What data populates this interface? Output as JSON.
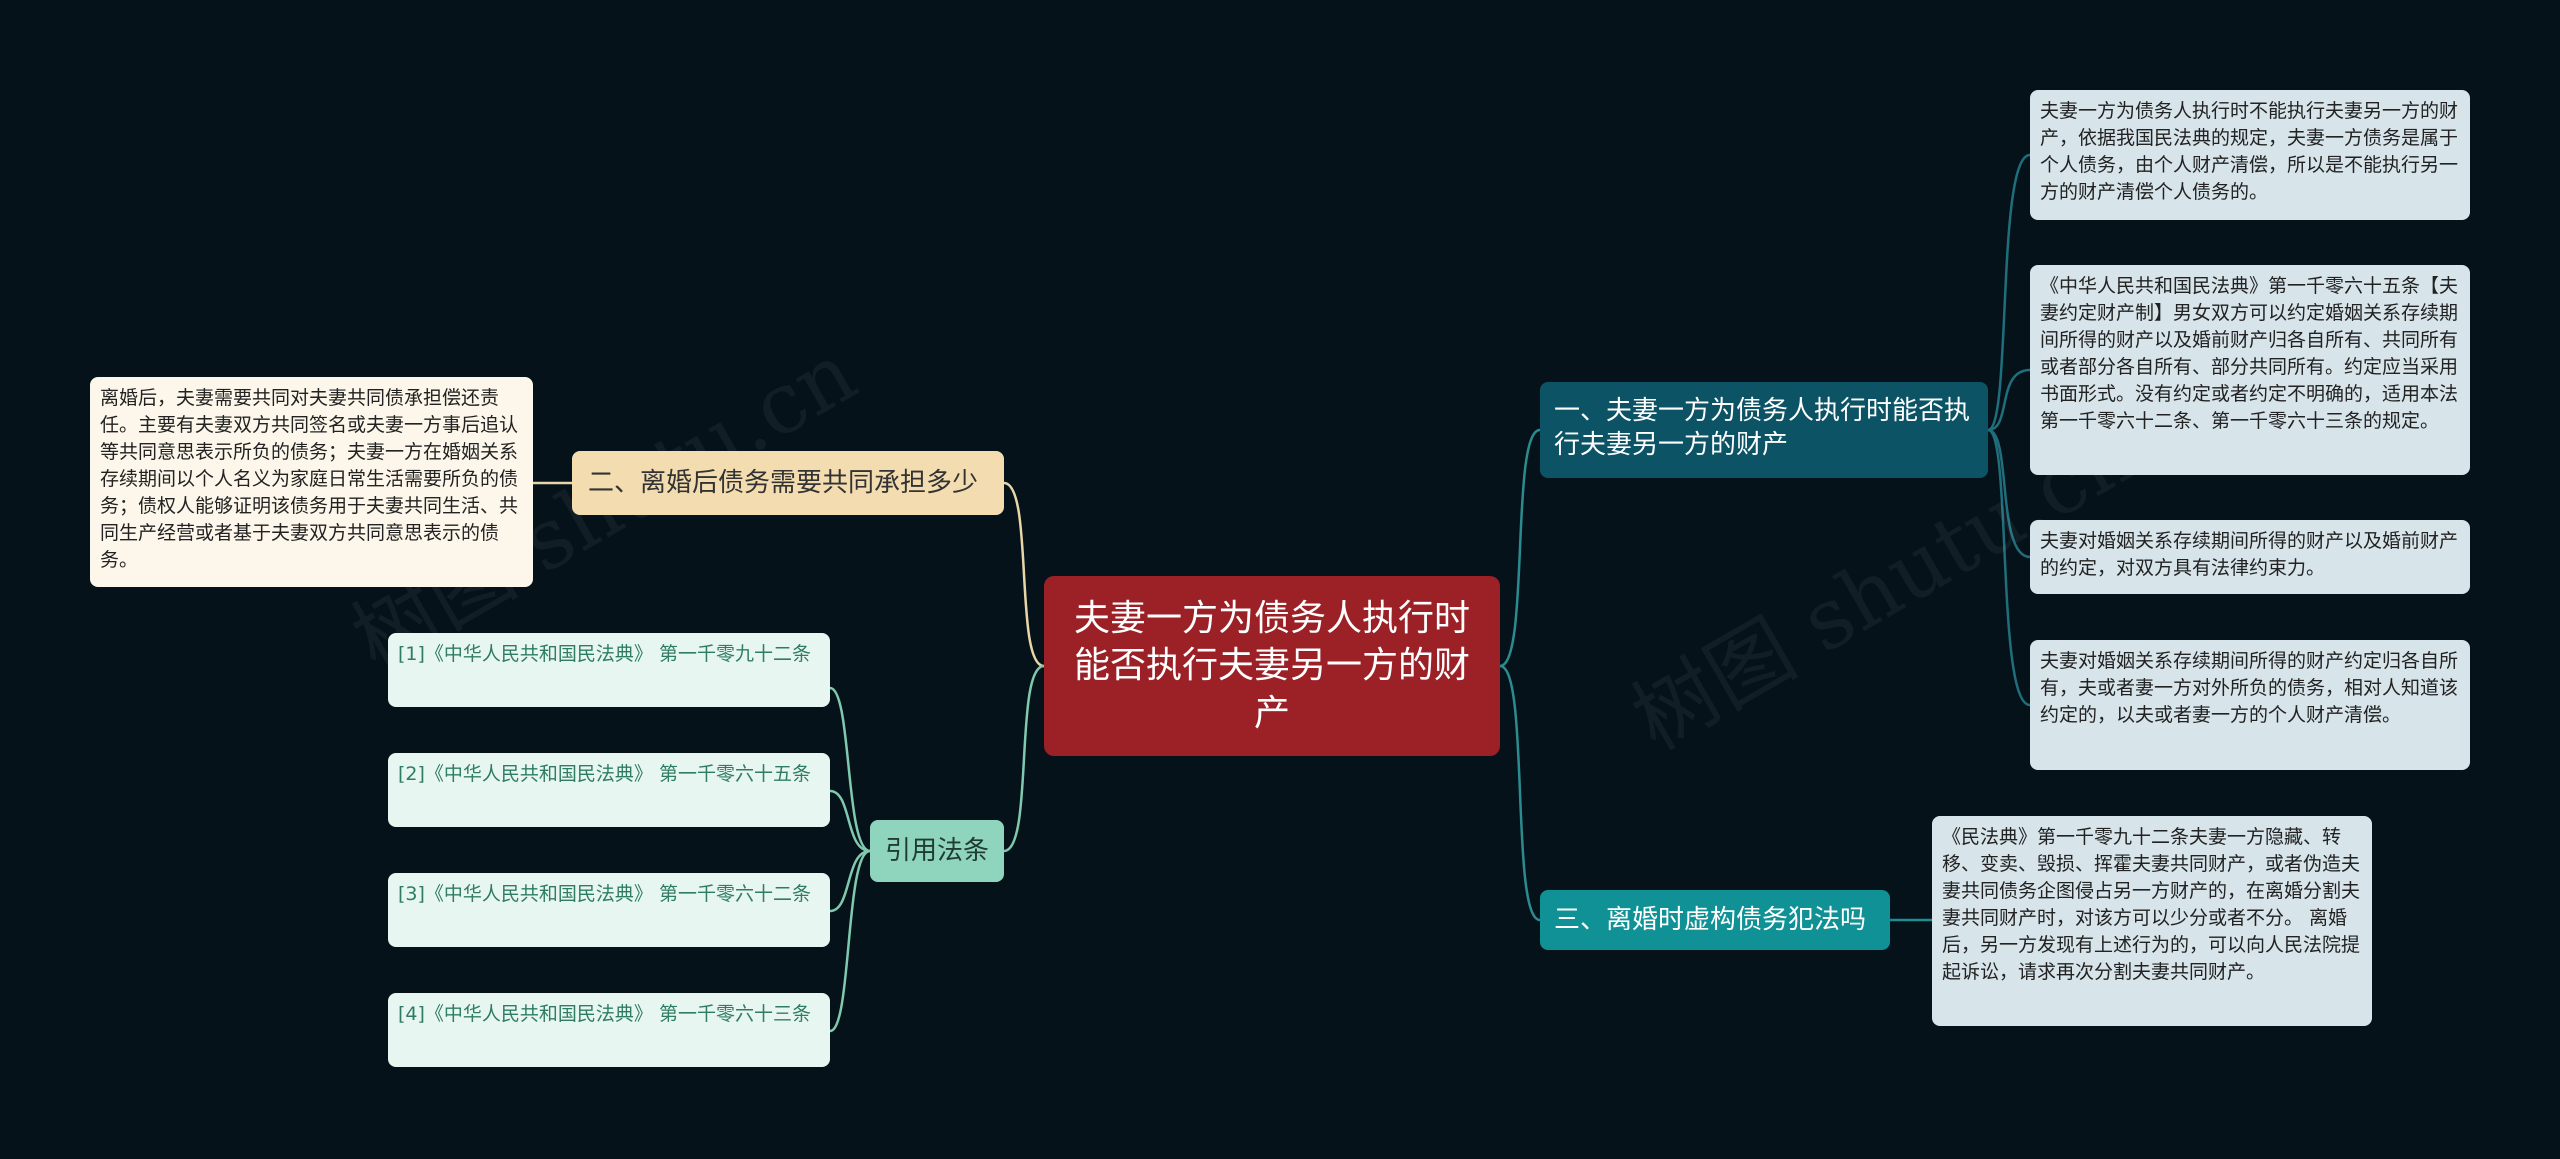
{
  "root": {
    "label": "夫妻一方为债务人执行时能否执行夫妻另一方的财产"
  },
  "branches": {
    "b1": {
      "label": "一、夫妻一方为债务人执行时能否执行夫妻另一方的财产",
      "leaves": [
        "夫妻一方为债务人执行时不能执行夫妻另一方的财产，依据我国民法典的规定，夫妻一方债务是属于个人债务，由个人财产清偿，所以是不能执行另一方的财产清偿个人债务的。",
        "《中华人民共和国民法典》第一千零六十五条【夫妻约定财产制】男女双方可以约定婚姻关系存续期间所得的财产以及婚前财产归各自所有、共同所有或者部分各自所有、部分共同所有。约定应当采用书面形式。没有约定或者约定不明确的，适用本法第一千零六十二条、第一千零六十三条的规定。",
        "夫妻对婚姻关系存续期间所得的财产以及婚前财产的约定，对双方具有法律约束力。",
        "夫妻对婚姻关系存续期间所得的财产约定归各自所有，夫或者妻一方对外所负的债务，相对人知道该约定的，以夫或者妻一方的个人财产清偿。"
      ]
    },
    "b2": {
      "label": "二、离婚后债务需要共同承担多少",
      "leaves": [
        "离婚后，夫妻需要共同对夫妻共同债承担偿还责任。主要有夫妻双方共同签名或夫妻一方事后追认等共同意思表示所负的债务；夫妻一方在婚姻关系存续期间以个人名义为家庭日常生活需要所负的债务；债权人能够证明该债务用于夫妻共同生活、共同生产经营或者基于夫妻双方共同意思表示的债务。"
      ]
    },
    "b3": {
      "label": "三、离婚时虚构债务犯法吗",
      "leaves": [
        "《民法典》第一千零九十二条夫妻一方隐藏、转移、变卖、毁损、挥霍夫妻共同财产，或者伪造夫妻共同债务企图侵占另一方财产的，在离婚分割夫妻共同财产时，对该方可以少分或者不分。 离婚后，另一方发现有上述行为的，可以向人民法院提起诉讼，请求再次分割夫妻共同财产。"
      ]
    },
    "b4": {
      "label": "引用法条",
      "leaves": [
        "[1]《中华人民共和国民法典》 第一千零九十二条",
        "[2]《中华人民共和国民法典》 第一千零六十五条",
        "[3]《中华人民共和国民法典》 第一千零六十二条",
        "[4]《中华人民共和国民法典》 第一千零六十三条"
      ]
    }
  },
  "watermark": "树图 shutu.cn",
  "colors": {
    "background": "#06121a",
    "root": "#9b2127",
    "branch_dark_teal": "#0c5465",
    "branch_teal": "#109196",
    "branch_tan": "#f3ddb0",
    "branch_mint": "#8fd5bd",
    "leaf_blue": "#d7e4ea",
    "leaf_cream": "#fcf7ea",
    "leaf_mint": "#e8f6f1",
    "connector": "#2a8c8f"
  }
}
